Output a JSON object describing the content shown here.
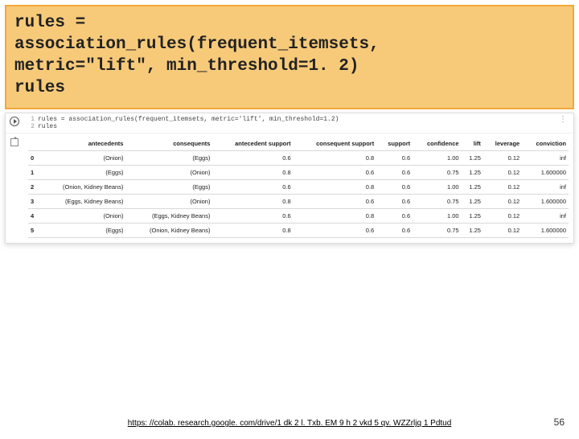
{
  "code_block": {
    "line1": "rules =",
    "line2": "association_rules(frequent_itemsets,",
    "line3": "metric=\"lift\", min_threshold=1. 2)",
    "line4": "rules"
  },
  "cell": {
    "ln1": "1",
    "code1": "rules = association_rules(frequent_itemsets, metric='lift', min_threshold=1.2)",
    "ln2": "2",
    "code2": "rules",
    "tools": "⋮"
  },
  "columns": {
    "idx": "",
    "antecedents": "antecedents",
    "consequents": "consequents",
    "antsup": "antecedent support",
    "consup": "consequent support",
    "support": "support",
    "confidence": "confidence",
    "lift": "lift",
    "leverage": "leverage",
    "conviction": "conviction"
  },
  "chart_data": {
    "type": "table",
    "title": "association_rules output",
    "columns": [
      "antecedents",
      "consequents",
      "antecedent support",
      "consequent support",
      "support",
      "confidence",
      "lift",
      "leverage",
      "conviction"
    ],
    "rows": [
      {
        "idx": "0",
        "antecedents": "(Onion)",
        "consequents": "(Eggs)",
        "antsup": "0.6",
        "consup": "0.8",
        "support": "0.6",
        "confidence": "1.00",
        "lift": "1.25",
        "leverage": "0.12",
        "conviction": "inf"
      },
      {
        "idx": "1",
        "antecedents": "(Eggs)",
        "consequents": "(Onion)",
        "antsup": "0.8",
        "consup": "0.6",
        "support": "0.6",
        "confidence": "0.75",
        "lift": "1.25",
        "leverage": "0.12",
        "conviction": "1.600000"
      },
      {
        "idx": "2",
        "antecedents": "(Onion, Kidney Beans)",
        "consequents": "(Eggs)",
        "antsup": "0.6",
        "consup": "0.8",
        "support": "0.6",
        "confidence": "1.00",
        "lift": "1.25",
        "leverage": "0.12",
        "conviction": "inf"
      },
      {
        "idx": "3",
        "antecedents": "(Eggs, Kidney Beans)",
        "consequents": "(Onion)",
        "antsup": "0.8",
        "consup": "0.6",
        "support": "0.6",
        "confidence": "0.75",
        "lift": "1.25",
        "leverage": "0.12",
        "conviction": "1.600000"
      },
      {
        "idx": "4",
        "antecedents": "(Onion)",
        "consequents": "(Eggs, Kidney Beans)",
        "antsup": "0.6",
        "consup": "0.8",
        "support": "0.6",
        "confidence": "1.00",
        "lift": "1.25",
        "leverage": "0.12",
        "conviction": "inf"
      },
      {
        "idx": "5",
        "antecedents": "(Eggs)",
        "consequents": "(Onion, Kidney Beans)",
        "antsup": "0.8",
        "consup": "0.6",
        "support": "0.6",
        "confidence": "0.75",
        "lift": "1.25",
        "leverage": "0.12",
        "conviction": "1.600000"
      }
    ]
  },
  "footer": {
    "url_text": "https: //colab. research.google. com/drive/1 dk 2 l. Txb. EM 9 h 2 vkd 5 qv. WZZrljq 1 Pdtud",
    "url_href": "https://colab.research.google.com/drive/1dk2lTxbEM9h2vkd5qvWZZrljq1Pdtud"
  },
  "page_number": "56"
}
